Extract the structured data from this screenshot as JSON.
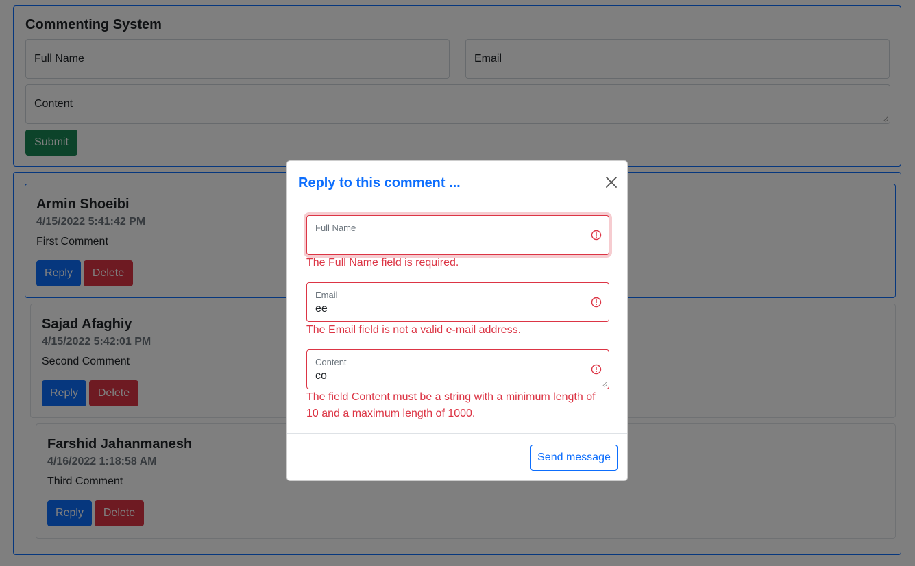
{
  "form": {
    "title": "Commenting System",
    "full_name_placeholder": "Full Name",
    "email_placeholder": "Email",
    "content_placeholder": "Content",
    "submit_label": "Submit"
  },
  "comments": [
    {
      "author": "Armin Shoeibi",
      "date": "4/15/2022 5:41:42 PM",
      "text": "First Comment",
      "reply_label": "Reply",
      "delete_label": "Delete"
    },
    {
      "author": "Sajad Afaghiy",
      "date": "4/15/2022 5:42:01 PM",
      "text": "Second Comment",
      "reply_label": "Reply",
      "delete_label": "Delete"
    },
    {
      "author": "Farshid Jahanmanesh",
      "date": "4/16/2022 1:18:58 AM",
      "text": "Third Comment",
      "reply_label": "Reply",
      "delete_label": "Delete"
    }
  ],
  "modal": {
    "title": "Reply to this comment ...",
    "full_name": {
      "label": "Full Name",
      "value": "",
      "error": "The Full Name field is required."
    },
    "email": {
      "label": "Email",
      "value": "ee",
      "error": "The Email field is not a valid e-mail address."
    },
    "content": {
      "label": "Content",
      "value": "co",
      "error": "The field Content must be a string with a minimum length of 10 and a maximum length of 1000."
    },
    "send_label": "Send message"
  },
  "colors": {
    "primary": "#0d6efd",
    "success": "#198754",
    "danger": "#dc3545",
    "muted": "#6c757d"
  },
  "icons": {
    "close": "close-icon",
    "error": "error-circle-icon",
    "resize": "resize-grip-icon"
  }
}
